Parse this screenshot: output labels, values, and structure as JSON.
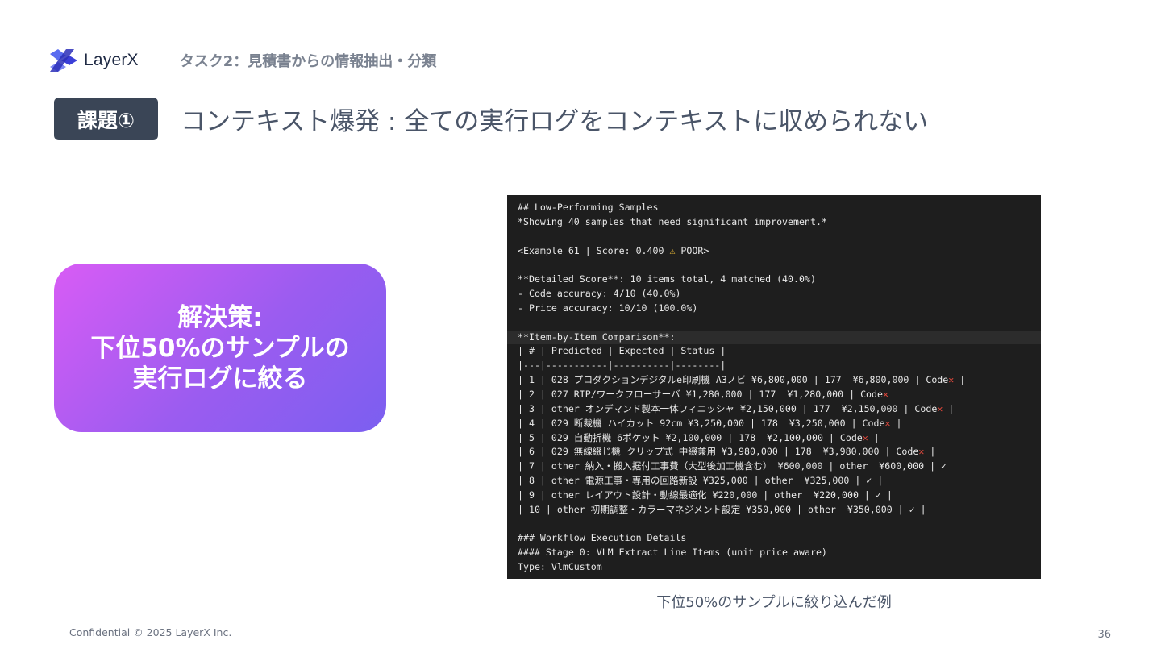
{
  "header": {
    "brand": "LayerX",
    "task": "タスク2：見積書からの情報抽出・分類"
  },
  "title": {
    "badge": "課題①",
    "text": "コンテキスト爆発 : 全ての実行ログをコンテキストに収められない"
  },
  "solution": {
    "line1": "解決策:",
    "line2": "下位50%のサンプルの",
    "line3": "実行ログに絞る"
  },
  "terminal": {
    "l01": "## Low-Performing Samples",
    "l02": "*Showing 40 samples that need significant improvement.*",
    "l04a": "<Example 61 | Score: 0.400 ",
    "l04b": "⚠",
    "l04c": " POOR>",
    "l06": "**Detailed Score**: 10 items total, 4 matched (40.0%)",
    "l07": "- Code accuracy: 4/10 (40.0%)",
    "l08": "- Price accuracy: 10/10 (100.0%)",
    "l10": "**Item-by-Item Comparison**:",
    "l11": "| # | Predicted | Expected | Status |",
    "l12": "|---|-----------|----------|--------|",
    "r1": "| 1 | 028 プロダクションデジタルe印刷機 A3ノビ ¥6,800,000 | 177  ¥6,800,000 | Code",
    "r2": "| 2 | 027 RIP/ワークフローサーバ ¥1,280,000 | 177  ¥1,280,000 | Code",
    "r3": "| 3 | other オンデマンド製本一体フィニッシャ ¥2,150,000 | 177  ¥2,150,000 | Code",
    "r4": "| 4 | 029 断裁機 ハイカット 92cm ¥3,250,000 | 178  ¥3,250,000 | Code",
    "r5": "| 5 | 029 自動折機 6ポケット ¥2,100,000 | 178  ¥2,100,000 | Code",
    "r6": "| 6 | 029 無線綴じ機 クリップ式 中綴兼用 ¥3,980,000 | 178  ¥3,980,000 | Code",
    "r7": "| 7 | other 納入・搬入据付工事費（大型後加工機含む） ¥600,000 | other  ¥600,000 | ✓ |",
    "r8": "| 8 | other 電源工事・専用の回路新設 ¥325,000 | other  ¥325,000 | ✓ |",
    "r9": "| 9 | other レイアウト設計・動線最適化 ¥220,000 | other  ¥220,000 | ✓ |",
    "r10": "| 10 | other 初期調整・カラーマネジメント設定 ¥350,000 | other  ¥350,000 | ✓ |",
    "x": "✕",
    "tail": " |",
    "l24": "### Workflow Execution Details",
    "l25": "#### Stage 0: VLM Extract Line Items (unit price aware)",
    "l26": "Type: VlmCustom"
  },
  "caption": "下位50%のサンプルに絞り込んだ例",
  "footer": {
    "confidential": "Confidential © 2025 LayerX Inc.",
    "page": "36"
  },
  "colors": {
    "badge_bg": "#3a4556",
    "gradient_start": "#d85cf5",
    "gradient_end": "#7b5ff0",
    "terminal_bg": "#1e1e1e",
    "logo_blue": "#3b3fd8",
    "x_mark": "#e2483c"
  }
}
